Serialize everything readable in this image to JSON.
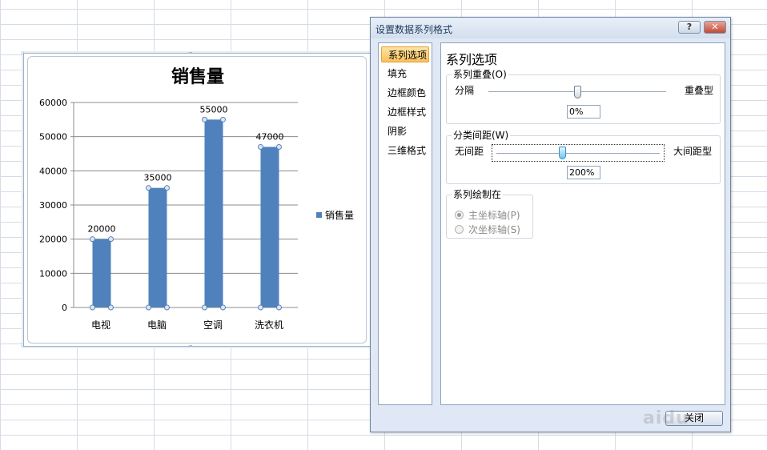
{
  "chart_data": {
    "type": "bar",
    "title": "销售量",
    "categories": [
      "电视",
      "电脑",
      "空调",
      "洗衣机"
    ],
    "series": [
      {
        "name": "销售量",
        "values": [
          20000,
          35000,
          55000,
          47000
        ],
        "color": "#4f81bd"
      }
    ],
    "data_labels": [
      "20000",
      "35000",
      "55000",
      "47000"
    ],
    "yticks": [
      "0",
      "10000",
      "20000",
      "30000",
      "40000",
      "50000",
      "60000"
    ],
    "ylim": [
      0,
      60000
    ],
    "grid": true,
    "legend": "right",
    "legend_label": "销售量"
  },
  "dialog": {
    "title": "设置数据系列格式",
    "help_label": "?",
    "close_icon_label": "✕",
    "nav_items": [
      {
        "label": "系列选项",
        "active": true
      },
      {
        "label": "填充",
        "active": false
      },
      {
        "label": "边框颜色",
        "active": false
      },
      {
        "label": "边框样式",
        "active": false
      },
      {
        "label": "阴影",
        "active": false
      },
      {
        "label": "三维格式",
        "active": false
      }
    ],
    "section_title": "系列选项",
    "overlap": {
      "legend": "系列重叠(O)",
      "left_label": "分隔",
      "right_label": "重叠型",
      "value": "0%",
      "level": 0.5
    },
    "gap": {
      "legend": "分类间距(W)",
      "left_label": "无间距",
      "right_label": "大间距型",
      "value": "200%",
      "level": 0.4
    },
    "plot_on": {
      "legend": "系列绘制在",
      "primary_label": "主坐标轴(P)",
      "secondary_label": "次坐标轴(S)",
      "selected": "primary"
    },
    "close_label": "关闭"
  },
  "watermark": "aidu"
}
